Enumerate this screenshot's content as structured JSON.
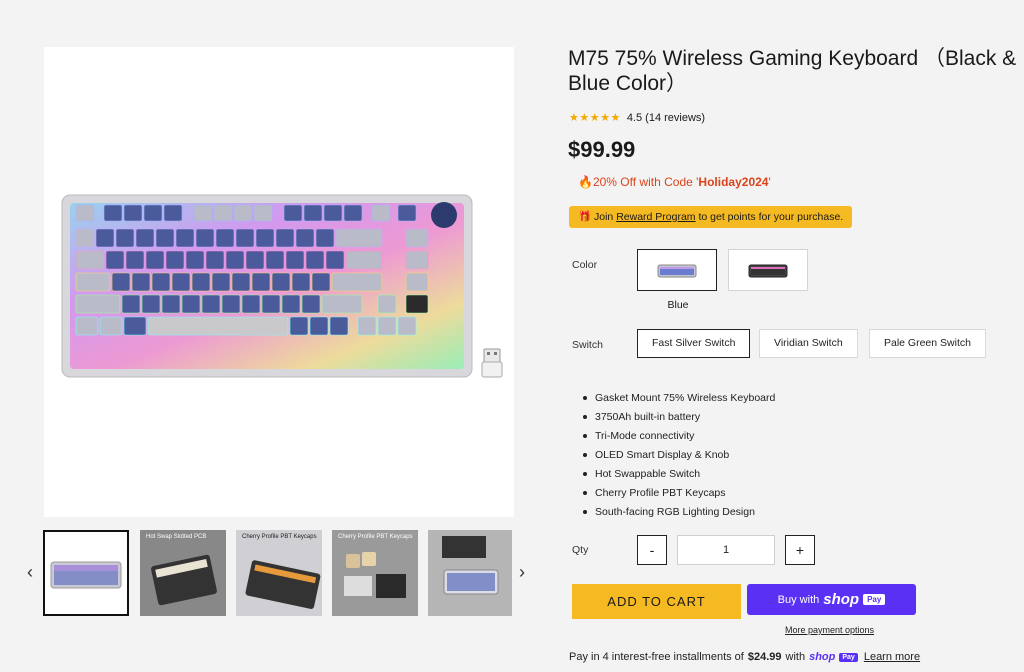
{
  "product": {
    "title": "M75 75% Wireless Gaming Keyboard （Black & Blue Color）",
    "rating_value": 4.5,
    "rating_text": "4.5 (14 reviews)",
    "price": "$99.99",
    "promo_prefix": "20% Off with Code '",
    "promo_code": "Holiday2024",
    "promo_suffix": "'",
    "reward_prefix": "Join ",
    "reward_link": "Reward Program",
    "reward_suffix": " to get points for your purchase."
  },
  "options": {
    "color_label": "Color",
    "color_selected": "Blue",
    "switch_label": "Switch",
    "switches": [
      "Fast Silver Switch",
      "Viridian Switch",
      "Pale Green Switch"
    ]
  },
  "features": [
    "Gasket Mount 75% Wireless Keyboard",
    "3750Ah built-in battery",
    "Tri-Mode connectivity",
    "OLED Smart Display & Knob",
    "Hot Swappable Switch",
    "Cherry Profile PBT Keycaps",
    "South-facing RGB Lighting Design"
  ],
  "quantity": {
    "label": "Qty",
    "minus": "-",
    "plus": "+",
    "value": "1"
  },
  "actions": {
    "add_to_cart": "ADD TO CART",
    "buy_with": "Buy with",
    "shop": "shop",
    "pay": "Pay",
    "more_payment": "More payment options"
  },
  "installments": {
    "prefix": "Pay in 4 interest-free installments of",
    "amount": "$24.99",
    "with": "with",
    "shop": "shop",
    "pay": "Pay",
    "learn_more": "Learn more"
  },
  "gallery": {
    "prev_icon": "chevron-left-icon",
    "next_icon": "chevron-right-icon",
    "thumb_captions": [
      "",
      "Hot Swap Slotted PCB",
      "Cherry Profile PBT Keycaps",
      "Cherry Profile PBT Keycaps",
      ""
    ]
  },
  "colors": {
    "accent_yellow": "#f5b921",
    "promo_red": "#d9441c",
    "shop_pay_purple": "#5a31f4",
    "star": "#f2a900"
  }
}
